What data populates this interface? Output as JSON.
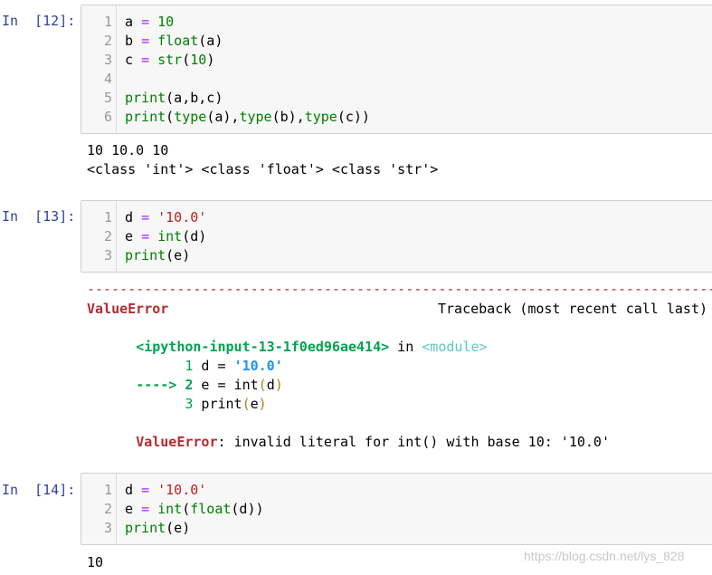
{
  "cells": [
    {
      "prompt": "In  [12]:",
      "lines": [
        {
          "n": "1",
          "text": "a = 10"
        },
        {
          "n": "2",
          "text": "b = float(a)"
        },
        {
          "n": "3",
          "text": "c = str(10)"
        },
        {
          "n": "4",
          "text": ""
        },
        {
          "n": "5",
          "text": "print(a,b,c)"
        },
        {
          "n": "6",
          "text": "print(type(a),type(b),type(c))"
        }
      ],
      "output": [
        "10 10.0 10",
        "<class 'int'> <class 'float'> <class 'str'>"
      ]
    },
    {
      "prompt": "In  [13]:",
      "lines": [
        {
          "n": "1",
          "text": "d = '10.0'"
        },
        {
          "n": "2",
          "text": "e = int(d)"
        },
        {
          "n": "3",
          "text": "print(e)"
        }
      ],
      "traceback": {
        "dashes": "-----------------------------------------------------------------------------------------------",
        "error_name": "ValueError",
        "header_right": "Traceback (most recent call last)",
        "input_ref": "<ipython-input-13-1f0ed96ae414>",
        "in_word": " in ",
        "module": "<module>",
        "lines": [
          {
            "marker": "      ",
            "n": "1",
            "text": " d = '10.0'"
          },
          {
            "marker": "----> ",
            "n": "2",
            "text": " e = int(d)"
          },
          {
            "marker": "      ",
            "n": "3",
            "text": " print(e)"
          }
        ],
        "final_error": "ValueError",
        "final_message": ": invalid literal for int() with base 10: '10.0'"
      }
    },
    {
      "prompt": "In  [14]:",
      "lines": [
        {
          "n": "1",
          "text": "d = '10.0'"
        },
        {
          "n": "2",
          "text": "e = int(float(d))"
        },
        {
          "n": "3",
          "text": "print(e)"
        }
      ],
      "output": [
        "10"
      ]
    }
  ],
  "watermark": "https://blog.csdn.net/lys_828"
}
